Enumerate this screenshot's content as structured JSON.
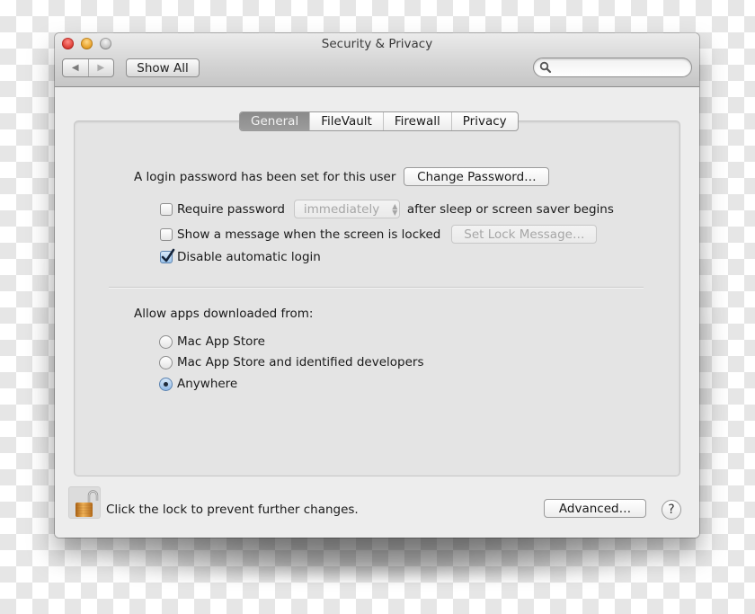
{
  "window": {
    "title": "Security & Privacy",
    "show_all_label": "Show All",
    "search_placeholder": "",
    "nav_back_icon": "◀",
    "nav_forward_icon": "▶"
  },
  "tabs": [
    {
      "label": "General",
      "active": true
    },
    {
      "label": "FileVault",
      "active": false
    },
    {
      "label": "Firewall",
      "active": false
    },
    {
      "label": "Privacy",
      "active": false
    }
  ],
  "general": {
    "login_password_text": "A login password has been set for this user",
    "change_password_label": "Change Password…",
    "require_password": {
      "label": "Require password",
      "checked": false,
      "delay_value": "immediately",
      "suffix": "after sleep or screen saver begins"
    },
    "show_message": {
      "label": "Show a message when the screen is locked",
      "checked": false,
      "button_label": "Set Lock Message…"
    },
    "disable_auto_login": {
      "label": "Disable automatic login",
      "checked": true
    },
    "allow_apps": {
      "heading": "Allow apps downloaded from:",
      "options": [
        {
          "label": "Mac App Store",
          "selected": false
        },
        {
          "label": "Mac App Store and identified developers",
          "selected": false
        },
        {
          "label": "Anywhere",
          "selected": true
        }
      ]
    }
  },
  "footer": {
    "lock_text": "Click the lock to prevent further changes.",
    "lock_state": "unlocked",
    "advanced_label": "Advanced…",
    "help_label": "?"
  }
}
